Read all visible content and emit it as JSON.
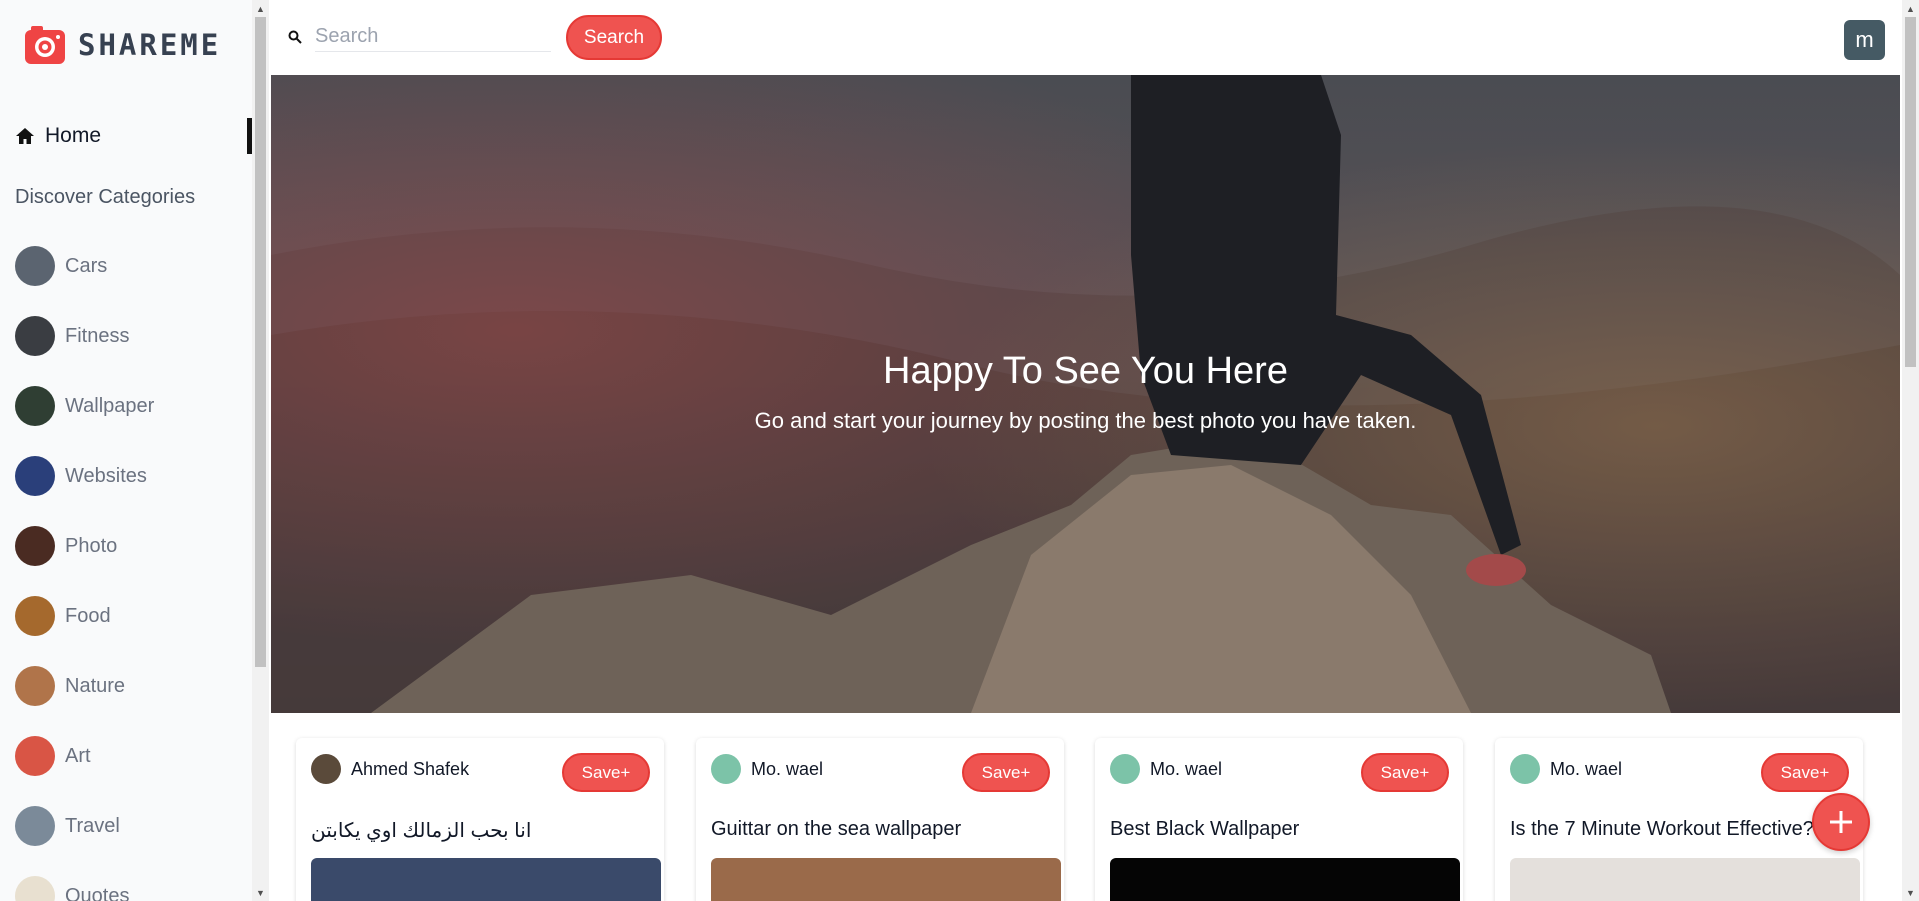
{
  "app": {
    "logo_text": "SHAREME",
    "logo_icon": "camera-icon"
  },
  "sidebar": {
    "home_label": "Home",
    "discover_label": "Discover Categories",
    "categories": [
      {
        "label": "Cars",
        "color": "#5b6470"
      },
      {
        "label": "Fitness",
        "color": "#3a3d42"
      },
      {
        "label": "Wallpaper",
        "color": "#2f3e33"
      },
      {
        "label": "Websites",
        "color": "#2a3f7a"
      },
      {
        "label": "Photo",
        "color": "#4a2b22"
      },
      {
        "label": "Food",
        "color": "#a5692d"
      },
      {
        "label": "Nature",
        "color": "#b0744a"
      },
      {
        "label": "Art",
        "color": "#d95545"
      },
      {
        "label": "Travel",
        "color": "#7b8a99"
      },
      {
        "label": "Quotes",
        "color": "#e8e0d0"
      }
    ]
  },
  "header": {
    "search_placeholder": "Search",
    "search_button": "Search",
    "user_initial": "m"
  },
  "hero": {
    "title": "Happy To See You Here",
    "subtitle": "Go and start your journey by posting the best photo you have taken."
  },
  "pins": [
    {
      "author": "Ahmed Shafek",
      "save_label": "Save+",
      "title": "انا بحب الزمالك اوي يكابتن",
      "avatar_color": "#5a4a3a",
      "image_color": "#3a4a6a"
    },
    {
      "author": "Mo. wael",
      "save_label": "Save+",
      "title": "Guittar on the sea wallpaper",
      "avatar_color": "#7cc3a8",
      "image_color": "#9a6a4a"
    },
    {
      "author": "Mo. wael",
      "save_label": "Save+",
      "title": "Best Black Wallpaper",
      "avatar_color": "#7cc3a8",
      "image_color": "#050505"
    },
    {
      "author": "Mo. wael",
      "save_label": "Save+",
      "title": "Is the 7 Minute Workout Effective?",
      "avatar_color": "#7cc3a8",
      "image_color": "#e4e0dc"
    }
  ],
  "colors": {
    "accent": "#ef5350",
    "user_avatar_bg": "#455a64"
  }
}
